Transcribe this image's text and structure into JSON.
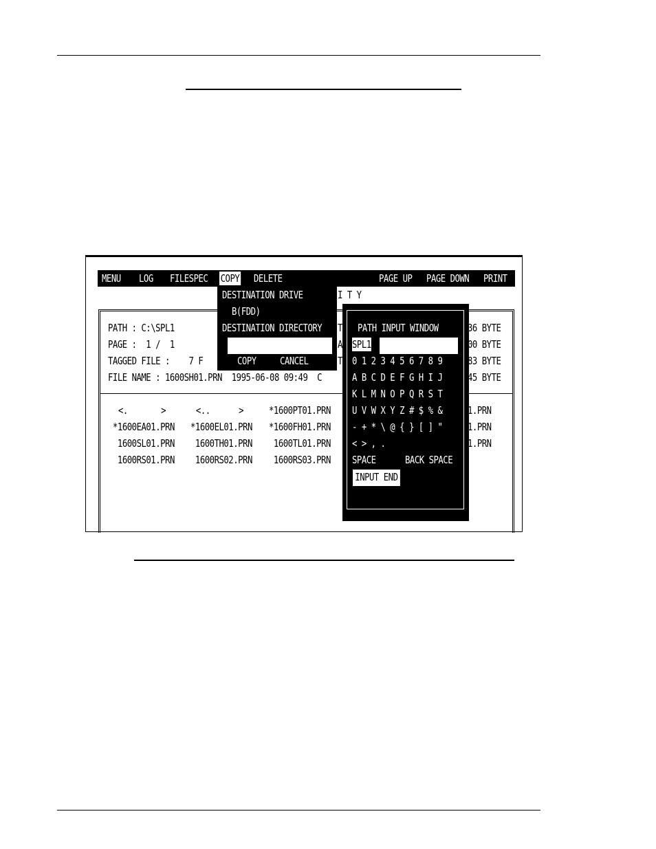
{
  "menubar": {
    "menu": "MENU",
    "log": "LOG",
    "filespec": "FILESPEC",
    "copy": "COPY",
    "delete": "DELETE",
    "page_up": "PAGE UP",
    "page_down": "PAGE DOWN",
    "print": "PRINT"
  },
  "utility_fragment": "I T Y",
  "file_info": {
    "path": "PATH : C:\\SPL1",
    "page": "PAGE :  1 /  1",
    "tagged": "TAGGED FILE :    7 F",
    "filename": "FILE NAME : 1600SH01.PRN  1995-06-08 09:49  C",
    "col_t1": "T",
    "col_a": "A",
    "col_t2": "T",
    "size1": "36 BYTE",
    "size2": "00 BYTE",
    "size3": "83 BYTE",
    "size4": "45 BYTE"
  },
  "files": {
    "row1": [
      " <.       > ",
      " <..      > ",
      "*1600PT01.PRN",
      "1.PRN"
    ],
    "row2": [
      "*1600EA01.PRN",
      "*1600EL01.PRN",
      "*1600FH01.PRN",
      "1.PRN"
    ],
    "row3": [
      " 1600SL01.PRN",
      " 1600TH01.PRN",
      " 1600TL01.PRN",
      "1.PRN"
    ],
    "row4": [
      " 1600RS01.PRN",
      " 1600RS02.PRN",
      " 1600RS03.PRN"
    ]
  },
  "copy_menu": {
    "dest_drive": "DESTINATION DRIVE",
    "drive_value": "B(FDD)",
    "dest_dir": "DESTINATION DIRECTORY",
    "dir_value": "",
    "copy_btn": "COPY",
    "cancel_btn": "CANCEL"
  },
  "path_window": {
    "title": "PATH INPUT WINDOW",
    "current": "SPL1",
    "digits": "0 1 2 3 4 5 6 7 8 9",
    "row_a": "A B C D E F G H I J",
    "row_k": "K L M N O P Q R S T",
    "row_u": "U V W X Y Z # $ % &",
    "row_sym": "- + * \\ @ { } [ ] \"",
    "row_sym2": "< > , .",
    "space": "SPACE",
    "backspace": "BACK SPACE",
    "input_end": "INPUT END"
  }
}
